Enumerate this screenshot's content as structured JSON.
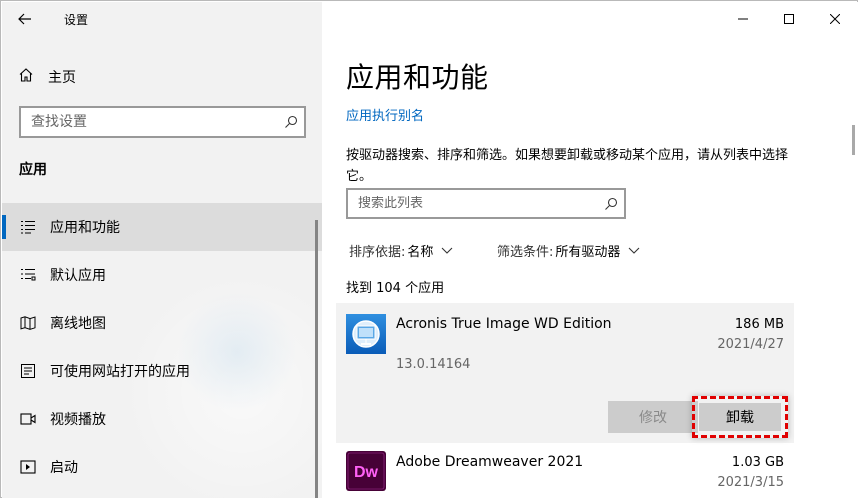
{
  "window": {
    "title": "设置",
    "controls": [
      "minimize",
      "maximize",
      "close"
    ]
  },
  "sidebar": {
    "home_label": "主页",
    "search_placeholder": "查找设置",
    "section_heading": "应用",
    "items": [
      {
        "label": "应用和功能",
        "icon": "apps-features-icon",
        "active": true
      },
      {
        "label": "默认应用",
        "icon": "default-apps-icon",
        "active": false
      },
      {
        "label": "离线地图",
        "icon": "offline-maps-icon",
        "active": false
      },
      {
        "label": "可使用网站打开的应用",
        "icon": "apps-for-websites-icon",
        "active": false
      },
      {
        "label": "视频播放",
        "icon": "video-playback-icon",
        "active": false
      },
      {
        "label": "启动",
        "icon": "startup-icon",
        "active": false
      }
    ]
  },
  "main": {
    "title": "应用和功能",
    "alias_link": "应用执行别名",
    "description": "按驱动器搜索、排序和筛选。如果想要卸载或移动某个应用，请从列表中选择它。",
    "list_search_placeholder": "搜索此列表",
    "sort": {
      "label": "排序依据:",
      "value": "名称"
    },
    "filter": {
      "label": "筛选条件:",
      "value": "所有驱动器"
    },
    "found_text": "找到 104 个应用",
    "apps": [
      {
        "name": "Acronis True Image WD Edition",
        "size": "186 MB",
        "date": "2021/4/27",
        "version": "13.0.14164",
        "expanded": true,
        "modify_label": "修改",
        "uninstall_label": "卸载"
      },
      {
        "name": "Adobe Dreamweaver 2021",
        "size": "1.03 GB",
        "date": "2021/3/15",
        "icon_text": "Dw",
        "expanded": false
      }
    ]
  },
  "colors": {
    "accent": "#0067c0",
    "sidebar_bg": "#f2f2f2",
    "highlight_dash": "#e00000",
    "dw_icon_bg": "#470137",
    "dw_icon_fg": "#ff61f6"
  }
}
